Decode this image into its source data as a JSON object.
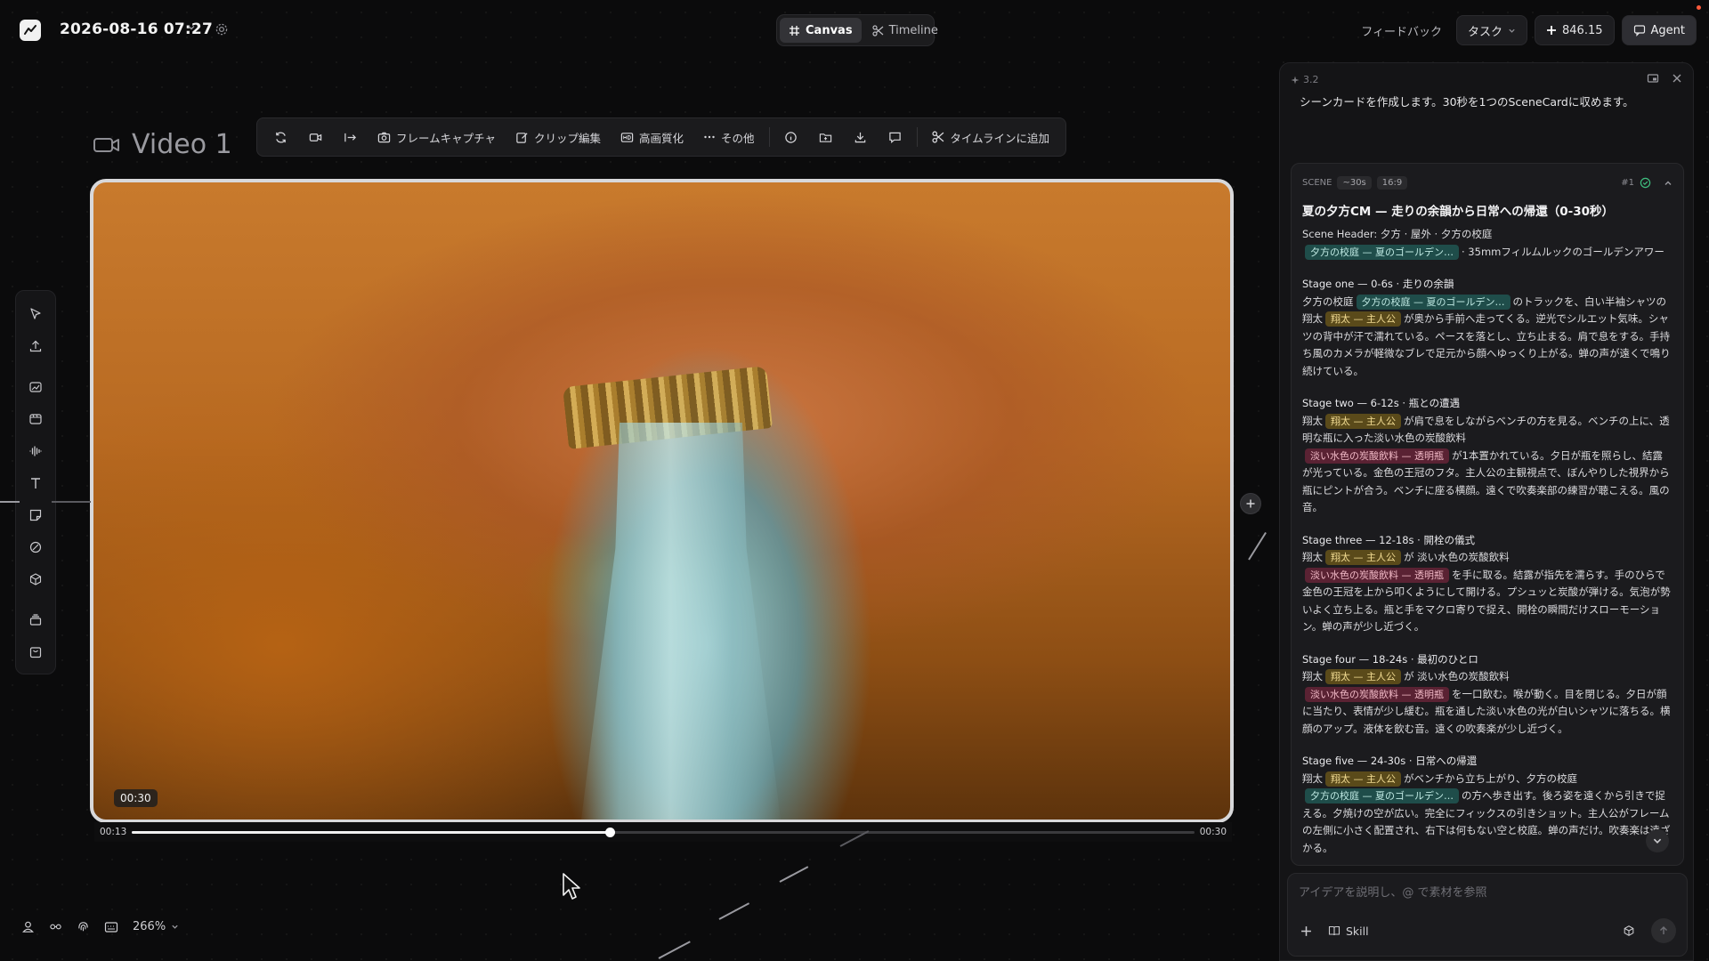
{
  "header": {
    "project_title": "2026-08-16 07:27",
    "modes": [
      {
        "label": "Canvas",
        "active": true
      },
      {
        "label": "Timeline",
        "active": false
      }
    ],
    "feedback_label": "フィードバック",
    "task_label": "タスク",
    "credits": "846.15",
    "agent_label": "Agent"
  },
  "canvas": {
    "video_title": "Video 1",
    "toolbar": {
      "frame_capture": "フレームキャプチャ",
      "clip_edit": "クリップ編集",
      "upscale": "高画質化",
      "more": "その他",
      "add_to_timeline": "タイムラインに追加"
    },
    "duration_badge": "00:30",
    "scrubber": {
      "current": "00:13",
      "total": "00:30",
      "progress_fraction": 0.45
    },
    "zoom": "266%"
  },
  "agent_panel": {
    "version": "3.2",
    "intro": "シーンカードを作成します。30秒を1つのSceneCardに収めます。",
    "scene": {
      "tag": "SCENE",
      "duration": "~30s",
      "ratio": "16:9",
      "index": "#1",
      "title": "夏の夕方CM — 走りの余韻から日常への帰還（0-30秒）",
      "header_line": "Scene Header: 夕方 · 屋外 · 夕方の校庭",
      "chip_location": "夕方の校庭 — 夏のゴールデン…",
      "chip_character": "翔太 — 主人公",
      "chip_prop": "淡い水色の炭酸飲料 — 透明瓶",
      "header_tail": "· 35mmフィルムルックのゴールデンアワー",
      "stages": [
        {
          "title": "Stage one — 0-6s · 走りの余韻"
        },
        {
          "title": "Stage two — 6-12s · 瓶との遭遇"
        },
        {
          "title": "Stage three — 12-18s · 開栓の儀式"
        },
        {
          "title": "Stage four — 18-24s · 最初のひとロ"
        },
        {
          "title": "Stage five — 24-30s · 日常への帰還"
        }
      ],
      "s1": {
        "a": "夕方の校庭",
        "b": "のトラックを、白い半袖シャツの翔太",
        "c": "が奥から手前へ走ってくる。逆光でシルエット気味。シャツの背中が汗で濡れている。ペースを落とし、立ち止まる。肩で息をする。手持ち風のカメラが軽微なブレで足元から顔へゆっくり上がる。蝉の声が遠くで鳴り続けている。"
      },
      "s2": {
        "a": "翔太",
        "b": "が肩で息をしながらベンチの方を見る。ベンチの上に、透明な瓶に入った淡い水色の炭酸飲料",
        "c": "が1本置かれている。夕日が瓶を照らし、結露が光っている。金色の王冠のフタ。主人公の主観視点で、ぼんやりした視界から瓶にピントが合う。ベンチに座る横顔。遠くで吹奏楽部の練習が聴こえる。風の音。"
      },
      "s3": {
        "a": "翔太",
        "b": "が 淡い水色の炭酸飲料",
        "c": "を手に取る。結露が指先を濡らす。手のひらで金色の王冠を上から叩くようにして開ける。プシュッと炭酸が弾ける。気泡が勢いよく立ち上る。瓶と手をマクロ寄りで捉え、開栓の瞬間だけスローモーション。蝉の声が少し近づく。"
      },
      "s4": {
        "a": "翔太",
        "b": "が 淡い水色の炭酸飲料",
        "c": "を一口飲む。喉が動く。目を閉じる。夕日が顔に当たり、表情が少し緩む。瓶を通した淡い水色の光が白いシャツに落ちる。横顔のアップ。液体を飲む音。遠くの吹奏楽が少し近づく。"
      },
      "s5": {
        "a": "翔太",
        "b": "がベンチから立ち上がり、夕方の校庭",
        "c": "の方へ歩き出す。後ろ姿を遠くから引きで捉える。夕焼けの空が広い。完全にフィックスの引きショット。主人公がフレームの左側に小さく配置され、右下は何もない空と校庭。蝉の声だけ。吹奏楽は遠ざかる。"
      }
    },
    "input_placeholder": "アイデアを説明し、@ で素材を参照",
    "skill_label": "Skill"
  }
}
